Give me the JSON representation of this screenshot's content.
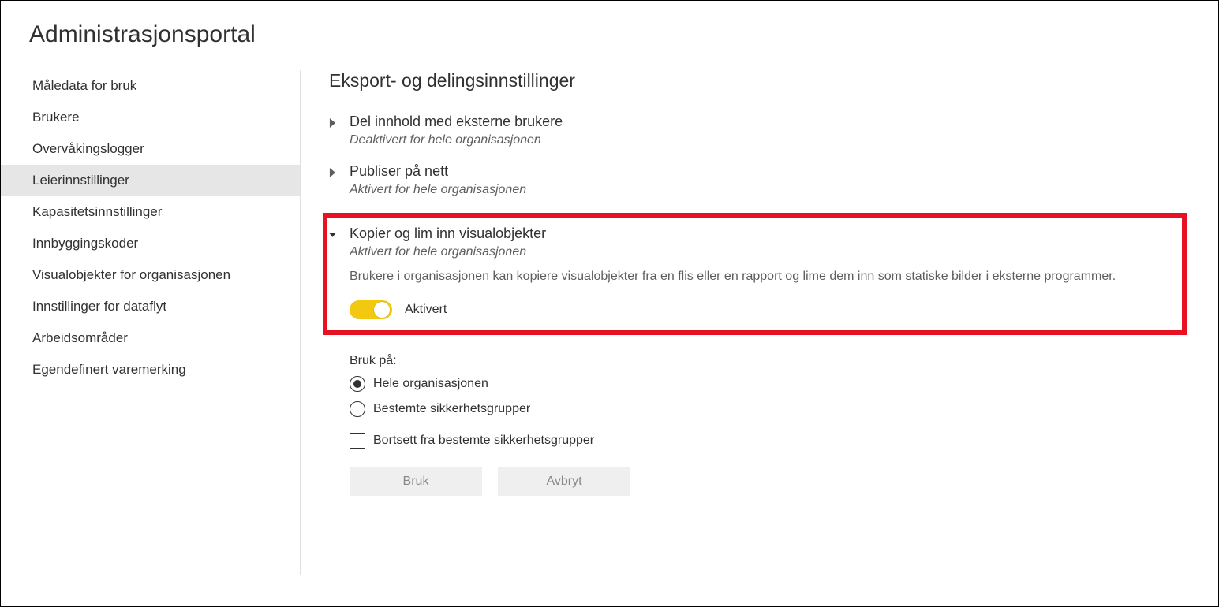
{
  "page_title": "Administrasjonsportal",
  "sidebar": {
    "items": [
      {
        "label": "Måledata for bruk"
      },
      {
        "label": "Brukere"
      },
      {
        "label": "Overvåkingslogger"
      },
      {
        "label": "Leierinnstillinger",
        "selected": true
      },
      {
        "label": "Kapasitetsinnstillinger"
      },
      {
        "label": "Innbyggingskoder"
      },
      {
        "label": "Visualobjekter for organisasjonen"
      },
      {
        "label": "Innstillinger for dataflyt"
      },
      {
        "label": "Arbeidsområder"
      },
      {
        "label": "Egendefinert varemerking"
      }
    ]
  },
  "section_title": "Eksport- og delingsinnstillinger",
  "settings": [
    {
      "title": "Del innhold med eksterne brukere",
      "status": "Deaktivert for hele organisasjonen",
      "expanded": false
    },
    {
      "title": "Publiser på nett",
      "status": "Aktivert for hele organisasjonen",
      "expanded": false
    },
    {
      "title": "Kopier og lim inn visualobjekter",
      "status": "Aktivert for hele organisasjonen",
      "expanded": true,
      "description": "Brukere i organisasjonen kan kopiere visualobjekter fra en flis eller en rapport og lime dem inn som statiske bilder i eksterne programmer.",
      "toggle_label": "Aktivert"
    }
  ],
  "apply": {
    "label": "Bruk på:",
    "options": [
      {
        "label": "Hele organisasjonen",
        "checked": true
      },
      {
        "label": "Bestemte sikkerhetsgrupper",
        "checked": false
      }
    ],
    "except_label": "Bortsett fra bestemte sikkerhetsgrupper"
  },
  "buttons": {
    "apply": "Bruk",
    "cancel": "Avbryt"
  },
  "colors": {
    "highlight": "#e81123",
    "toggle_on": "#f2c811"
  }
}
